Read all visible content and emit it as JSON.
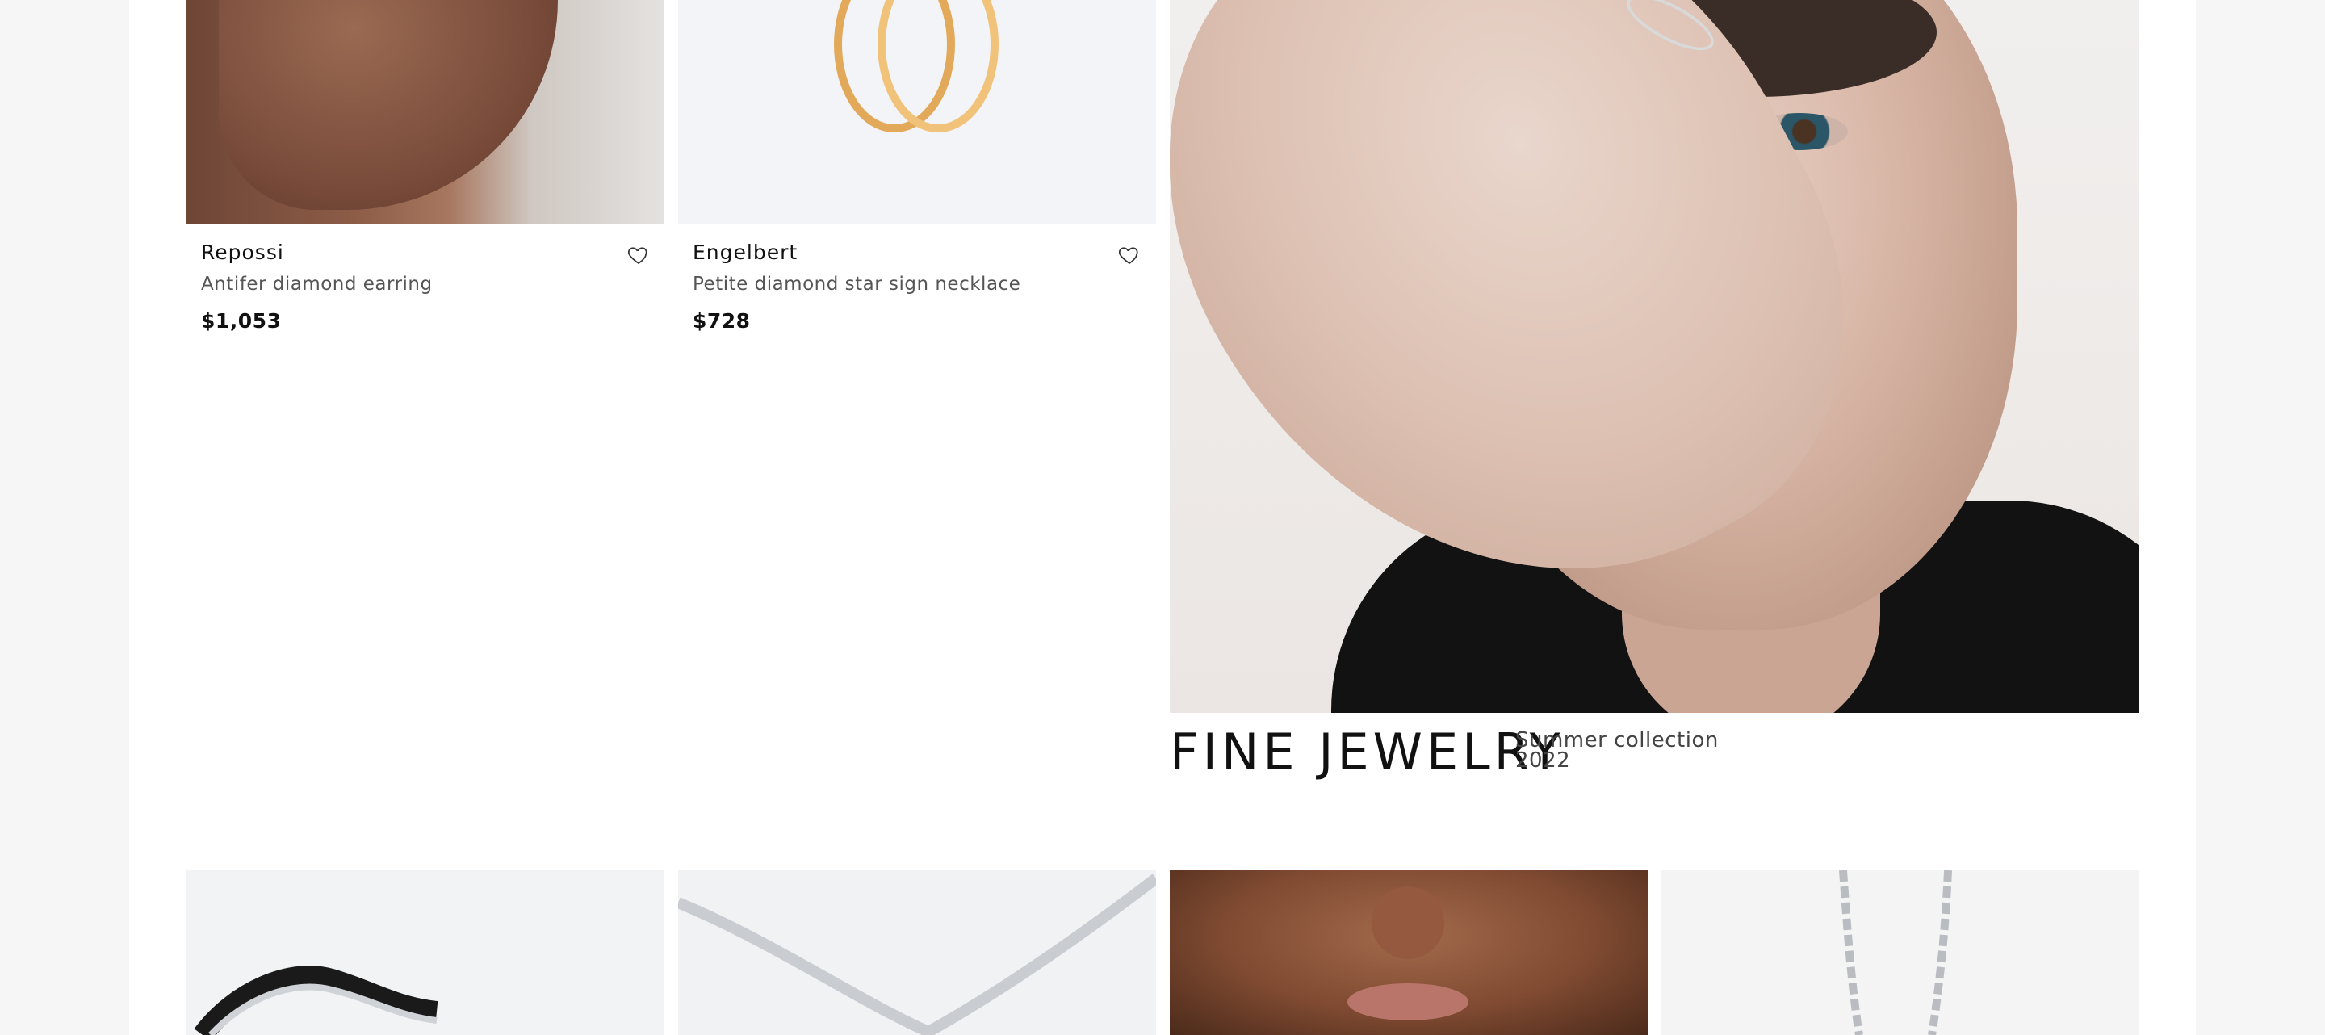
{
  "products": [
    {
      "brand": "Repossi",
      "description": "Antifer diamond earring",
      "price": "$1,053"
    },
    {
      "brand": "Engelbert",
      "description": "Petite diamond star sign necklace",
      "price": "$728"
    }
  ],
  "campaign": {
    "title": "FINE JEWELRY",
    "subtitle_line1": "Summer collection",
    "subtitle_line2": "2022"
  },
  "icons": {
    "wishlist": "heart-icon"
  },
  "colors": {
    "background": "#f6f6f6",
    "page": "#ffffff",
    "text": "#111111",
    "muted": "#555555"
  }
}
